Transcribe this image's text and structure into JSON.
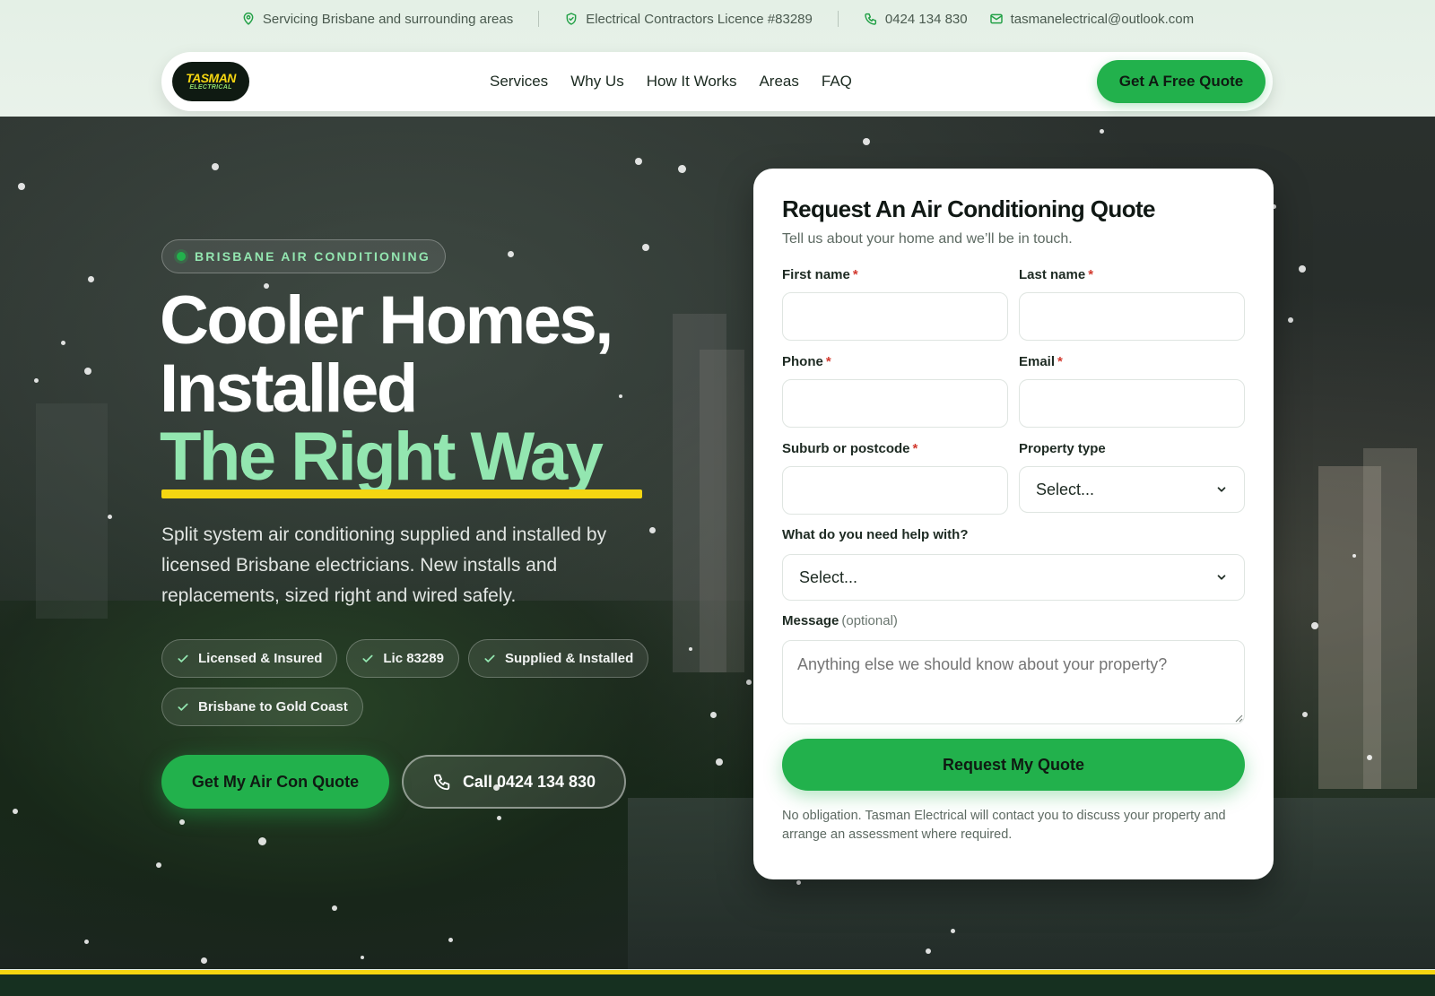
{
  "topbar": {
    "service_area": "Servicing Brisbane and surrounding areas",
    "licence": "Electrical Contractors Licence #83289",
    "phone": "0424 134 830",
    "email": "tasmanelectrical@outlook.com"
  },
  "nav": {
    "logo_line1": "TASMAN",
    "logo_line2": "ELECTRICAL",
    "links": [
      "Services",
      "Why Us",
      "How It Works",
      "Areas",
      "FAQ"
    ],
    "cta": "Get A Free Quote"
  },
  "hero": {
    "badge": "BRISBANE AIR CONDITIONING",
    "headline_line1": "Cooler Homes,",
    "headline_line2": "Installed",
    "headline_accent": "The Right Way",
    "subtext": "Split system air conditioning supplied and installed by licensed Brisbane electricians. New installs and replacements, sized right and wired safely.",
    "chips": [
      "Licensed & Insured",
      "Lic 83289",
      "Supplied & Installed",
      "Brisbane to Gold Coast"
    ],
    "primary_button": "Get My Air Con Quote",
    "call_button": "Call 0424 134 830"
  },
  "form": {
    "title": "Request An Air Conditioning Quote",
    "subtitle": "Tell us about your home and we’ll be in touch.",
    "first_name_label": "First name",
    "last_name_label": "Last name",
    "phone_label": "Phone",
    "email_label": "Email",
    "suburb_label": "Suburb or postcode",
    "property_label": "Property type",
    "property_value": "Select...",
    "help_label": "What do you need help with?",
    "help_value": "Select...",
    "message_label": "Message",
    "message_optional": "(optional)",
    "message_placeholder": "Anything else we should know about your property?",
    "required_mark": "*",
    "submit": "Request My Quote",
    "disclaimer": "No obligation. Tasman Electrical will contact you to discuss your property and arrange an assessment where required."
  },
  "colors": {
    "brand_green": "#22b14c",
    "accent_mint": "#93e6b0",
    "accent_yellow": "#f5d611",
    "hero_dark": "#262c29"
  },
  "icons": {
    "service_area": "map-pin-icon",
    "licence": "shield-check-icon",
    "phone": "phone-icon",
    "email": "mail-icon",
    "chip": "check-icon",
    "select": "chevron-down-icon"
  }
}
